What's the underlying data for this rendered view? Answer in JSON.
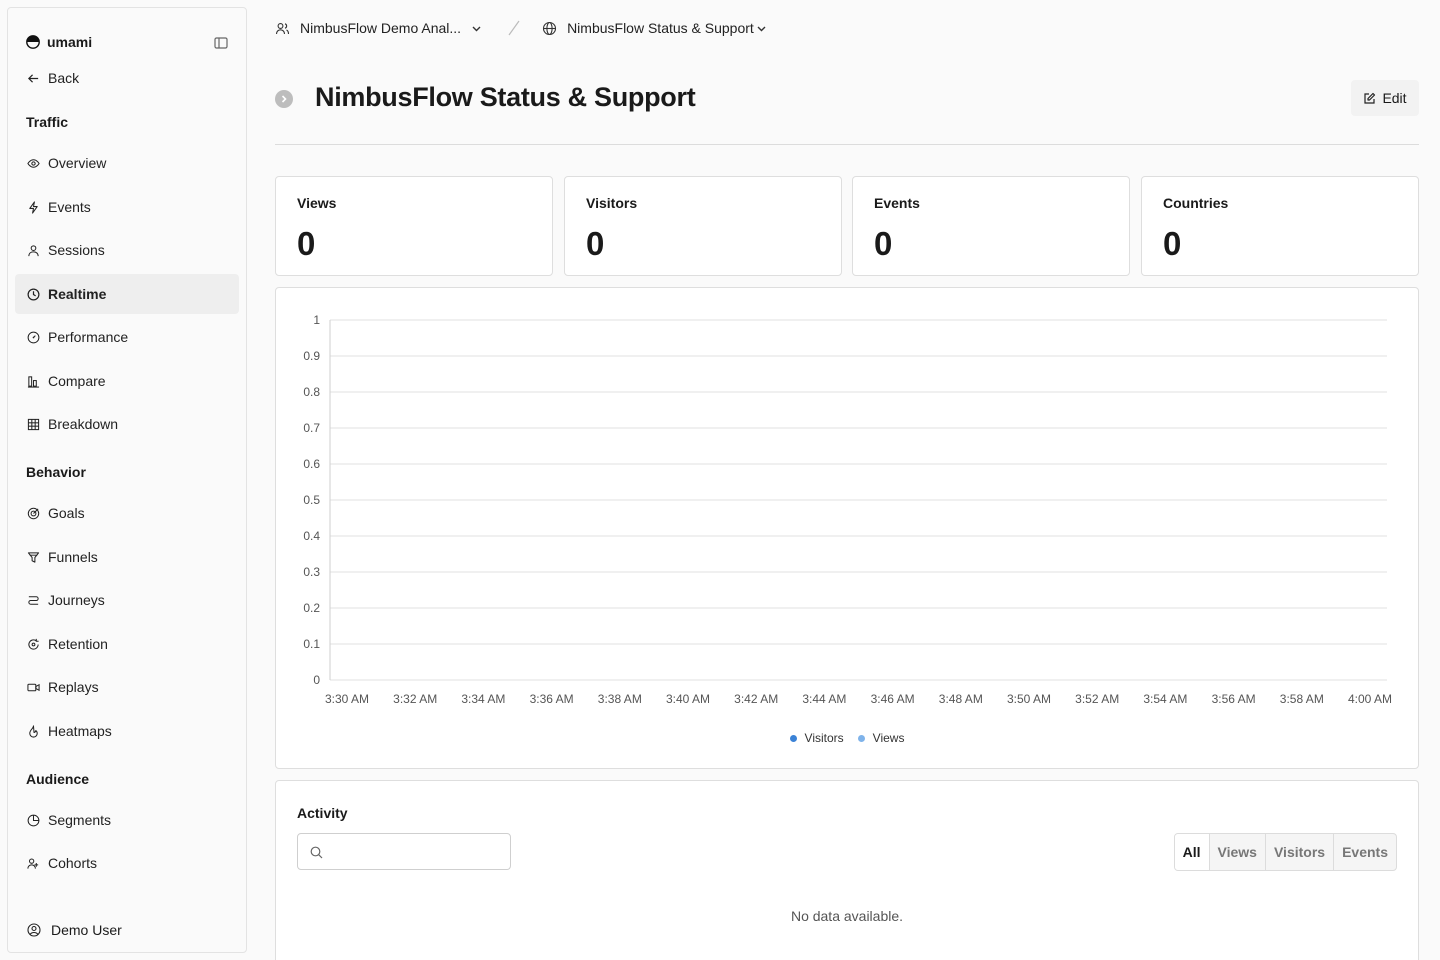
{
  "sidebar": {
    "brand": "umami",
    "back": "Back",
    "sections": {
      "traffic": "Traffic",
      "behavior": "Behavior",
      "audience": "Audience"
    },
    "traffic_items": [
      {
        "label": "Overview",
        "icon": "eye-icon"
      },
      {
        "label": "Events",
        "icon": "lightning-icon"
      },
      {
        "label": "Sessions",
        "icon": "user-icon"
      },
      {
        "label": "Realtime",
        "icon": "clock-icon",
        "active": true
      },
      {
        "label": "Performance",
        "icon": "gauge-icon"
      },
      {
        "label": "Compare",
        "icon": "compare-icon"
      },
      {
        "label": "Breakdown",
        "icon": "grid-icon"
      }
    ],
    "behavior_items": [
      {
        "label": "Goals",
        "icon": "target-icon"
      },
      {
        "label": "Funnels",
        "icon": "funnel-icon"
      },
      {
        "label": "Journeys",
        "icon": "journey-icon"
      },
      {
        "label": "Retention",
        "icon": "retention-icon"
      },
      {
        "label": "Replays",
        "icon": "video-icon"
      },
      {
        "label": "Heatmaps",
        "icon": "flame-icon"
      }
    ],
    "audience_items": [
      {
        "label": "Segments",
        "icon": "pie-icon"
      },
      {
        "label": "Cohorts",
        "icon": "users-icon"
      }
    ],
    "user": "Demo User"
  },
  "header": {
    "team": "NimbusFlow Demo Anal...",
    "website": "NimbusFlow Status & Support"
  },
  "page": {
    "title": "NimbusFlow Status & Support",
    "edit_label": "Edit"
  },
  "metrics": [
    {
      "label": "Views",
      "value": "0"
    },
    {
      "label": "Visitors",
      "value": "0"
    },
    {
      "label": "Events",
      "value": "0"
    },
    {
      "label": "Countries",
      "value": "0"
    }
  ],
  "chart_data": {
    "type": "bar",
    "x": [
      "3:30 AM",
      "3:32 AM",
      "3:34 AM",
      "3:36 AM",
      "3:38 AM",
      "3:40 AM",
      "3:42 AM",
      "3:44 AM",
      "3:46 AM",
      "3:48 AM",
      "3:50 AM",
      "3:52 AM",
      "3:54 AM",
      "3:56 AM",
      "3:58 AM",
      "4:00 AM"
    ],
    "yticks": [
      "0",
      "0.1",
      "0.2",
      "0.3",
      "0.4",
      "0.5",
      "0.6",
      "0.7",
      "0.8",
      "0.9",
      "1"
    ],
    "ylim": [
      0,
      1
    ],
    "series": [
      {
        "name": "Visitors",
        "values": [],
        "color": "#3b82d6"
      },
      {
        "name": "Views",
        "values": [],
        "color": "#7fb3ea"
      }
    ],
    "grid": true,
    "legend": "bottom-center"
  },
  "activity": {
    "title": "Activity",
    "search_placeholder": "",
    "filters": [
      "All",
      "Views",
      "Visitors",
      "Events"
    ],
    "active_filter": "All",
    "empty": "No data available."
  }
}
